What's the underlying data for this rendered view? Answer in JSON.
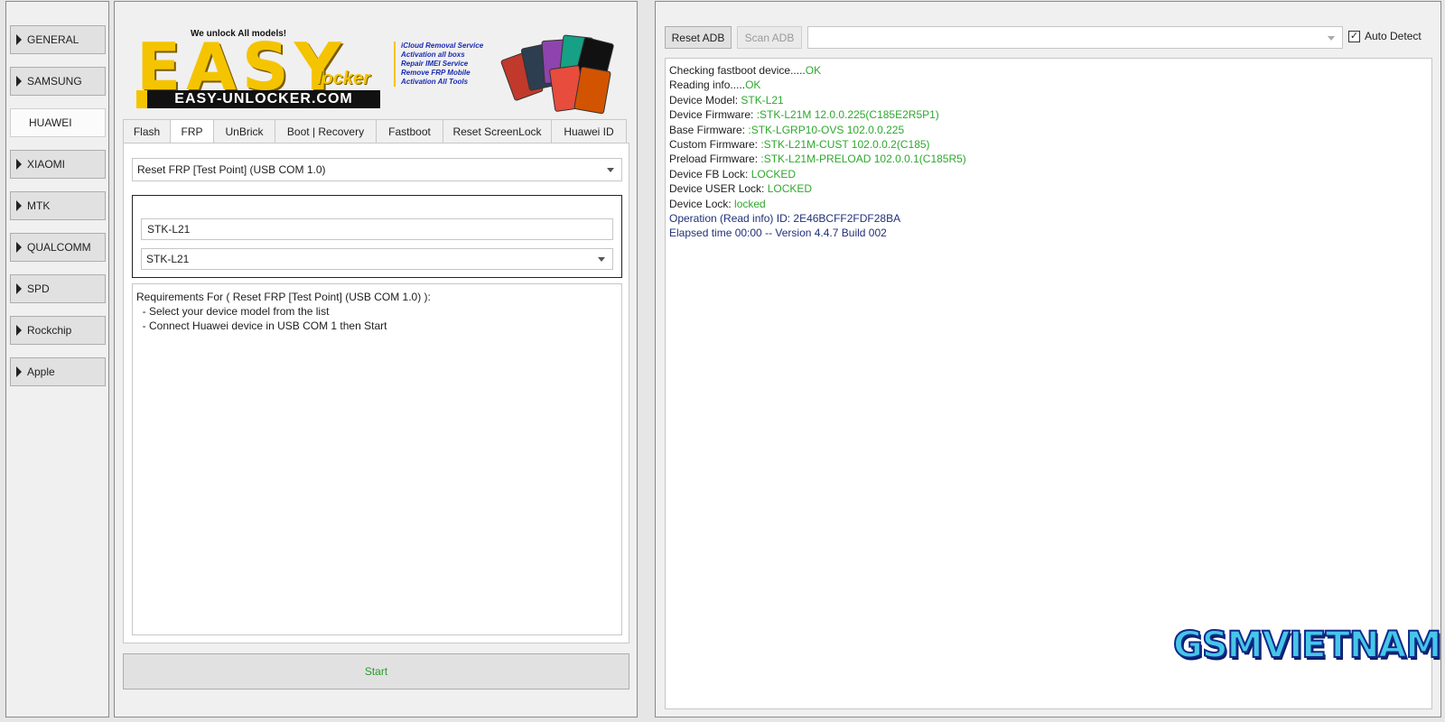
{
  "sidebar": {
    "items": [
      {
        "label": "GENERAL"
      },
      {
        "label": "SAMSUNG"
      },
      {
        "label": "HUAWEI"
      },
      {
        "label": "XIAOMI"
      },
      {
        "label": "MTK"
      },
      {
        "label": "QUALCOMM"
      },
      {
        "label": "SPD"
      },
      {
        "label": "Rockchip"
      },
      {
        "label": "Apple"
      }
    ],
    "active": "HUAWEI"
  },
  "logo": {
    "letters": "EASY",
    "tagline": "We unlock All models!",
    "url": "EASY-UNLOCKER.COM",
    "locker": "locker",
    "services": [
      "iCloud Removal Service",
      "Activation all boxs",
      "Repair IMEI Service",
      "Remove FRP Mobile",
      "Activation All Tools"
    ]
  },
  "tabs": [
    {
      "label": "Flash"
    },
    {
      "label": "FRP"
    },
    {
      "label": "UnBrick"
    },
    {
      "label": "Boot | Recovery"
    },
    {
      "label": "Fastboot"
    },
    {
      "label": "Reset ScreenLock"
    },
    {
      "label": "Huawei ID"
    }
  ],
  "active_tab": "FRP",
  "frp": {
    "operation_select": "Reset FRP [Test Point] (USB COM 1.0)",
    "model_input": "STK-L21",
    "model_select": "STK-L21",
    "requirements": [
      "Requirements For ( Reset FRP [Test Point] (USB COM 1.0) ):",
      "  - Select your device model from the list",
      "  - Connect Huawei device in USB COM 1 then Start"
    ]
  },
  "start_button": "Start",
  "toolbar": {
    "reset_adb": "Reset ADB",
    "scan_adb": "Scan ADB",
    "adb_select": "",
    "auto_detect": "Auto Detect",
    "auto_detect_checked": true
  },
  "log": [
    {
      "label": "Checking fastboot device.....",
      "value": "OK"
    },
    {
      "label": "Reading info.....",
      "value": "OK"
    },
    {
      "label": "Device Model: ",
      "value": "STK-L21"
    },
    {
      "label": "Device Firmware: ",
      "value": ":STK-L21M 12.0.0.225(C185E2R5P1)"
    },
    {
      "label": "Base Firmware: ",
      "value": ":STK-LGRP10-OVS 102.0.0.225"
    },
    {
      "label": "Custom Firmware: ",
      "value": ":STK-L21M-CUST 102.0.0.2(C185)"
    },
    {
      "label": "Preload Firmware: ",
      "value": ":STK-L21M-PRELOAD 102.0.0.1(C185R5)"
    },
    {
      "label": "Device FB Lock: ",
      "value": "LOCKED"
    },
    {
      "label": "Device USER Lock: ",
      "value": "LOCKED"
    },
    {
      "label": "Device Lock: ",
      "value": "locked"
    },
    {
      "info": "Operation (Read info) ID: 2E46BCFF2FDF28BA"
    },
    {
      "info": "Elapsed time 00:00 -- Version 4.4.7 Build 002"
    }
  ],
  "watermark": "GSMVIETNAM",
  "colors": {
    "ok_green": "#2ea82e",
    "info_blue": "#20307a",
    "logo_yellow": "#f5c400",
    "watermark_cyan": "#46c6e8"
  }
}
